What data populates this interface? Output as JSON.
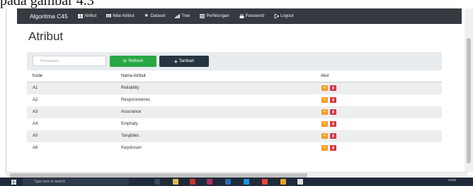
{
  "doc_caption": "pada gambar 4.3",
  "navbar": {
    "brand": "Algoritma C45",
    "items": [
      {
        "label": "Atribut",
        "icon": "table-icon"
      },
      {
        "label": "Nilai Atribut",
        "icon": "grid-icon"
      },
      {
        "label": "Dataset",
        "icon": "star-icon"
      },
      {
        "label": "Tree",
        "icon": "bar-chart-icon"
      },
      {
        "label": "Perhitungan",
        "icon": "list-icon"
      },
      {
        "label": "Password",
        "icon": "lock-icon"
      },
      {
        "label": "Logout",
        "icon": "logout-icon"
      }
    ]
  },
  "page": {
    "title": "Atribut",
    "search_placeholder": "Pencarian...",
    "refresh_label": "Refresh",
    "add_label": "Tambah"
  },
  "table": {
    "headers": [
      "Kode",
      "Nama Atribut",
      "Aksi"
    ],
    "rows": [
      {
        "kode": "A1",
        "nama": "Reliability"
      },
      {
        "kode": "A2",
        "nama": "Responsivenes"
      },
      {
        "kode": "A3",
        "nama": "Assurance"
      },
      {
        "kode": "A4",
        "nama": "Emphaty"
      },
      {
        "kode": "A5",
        "nama": "Tangibles"
      },
      {
        "kode": "A6",
        "nama": "Keputusan"
      }
    ]
  },
  "taskbar": {
    "search_placeholder": "Type here to search",
    "time": "10:52"
  },
  "colors": {
    "navbar": "#343a40",
    "refresh": "#28a745",
    "add": "#263540",
    "edit": "#f0a020",
    "delete": "#dc3545"
  }
}
